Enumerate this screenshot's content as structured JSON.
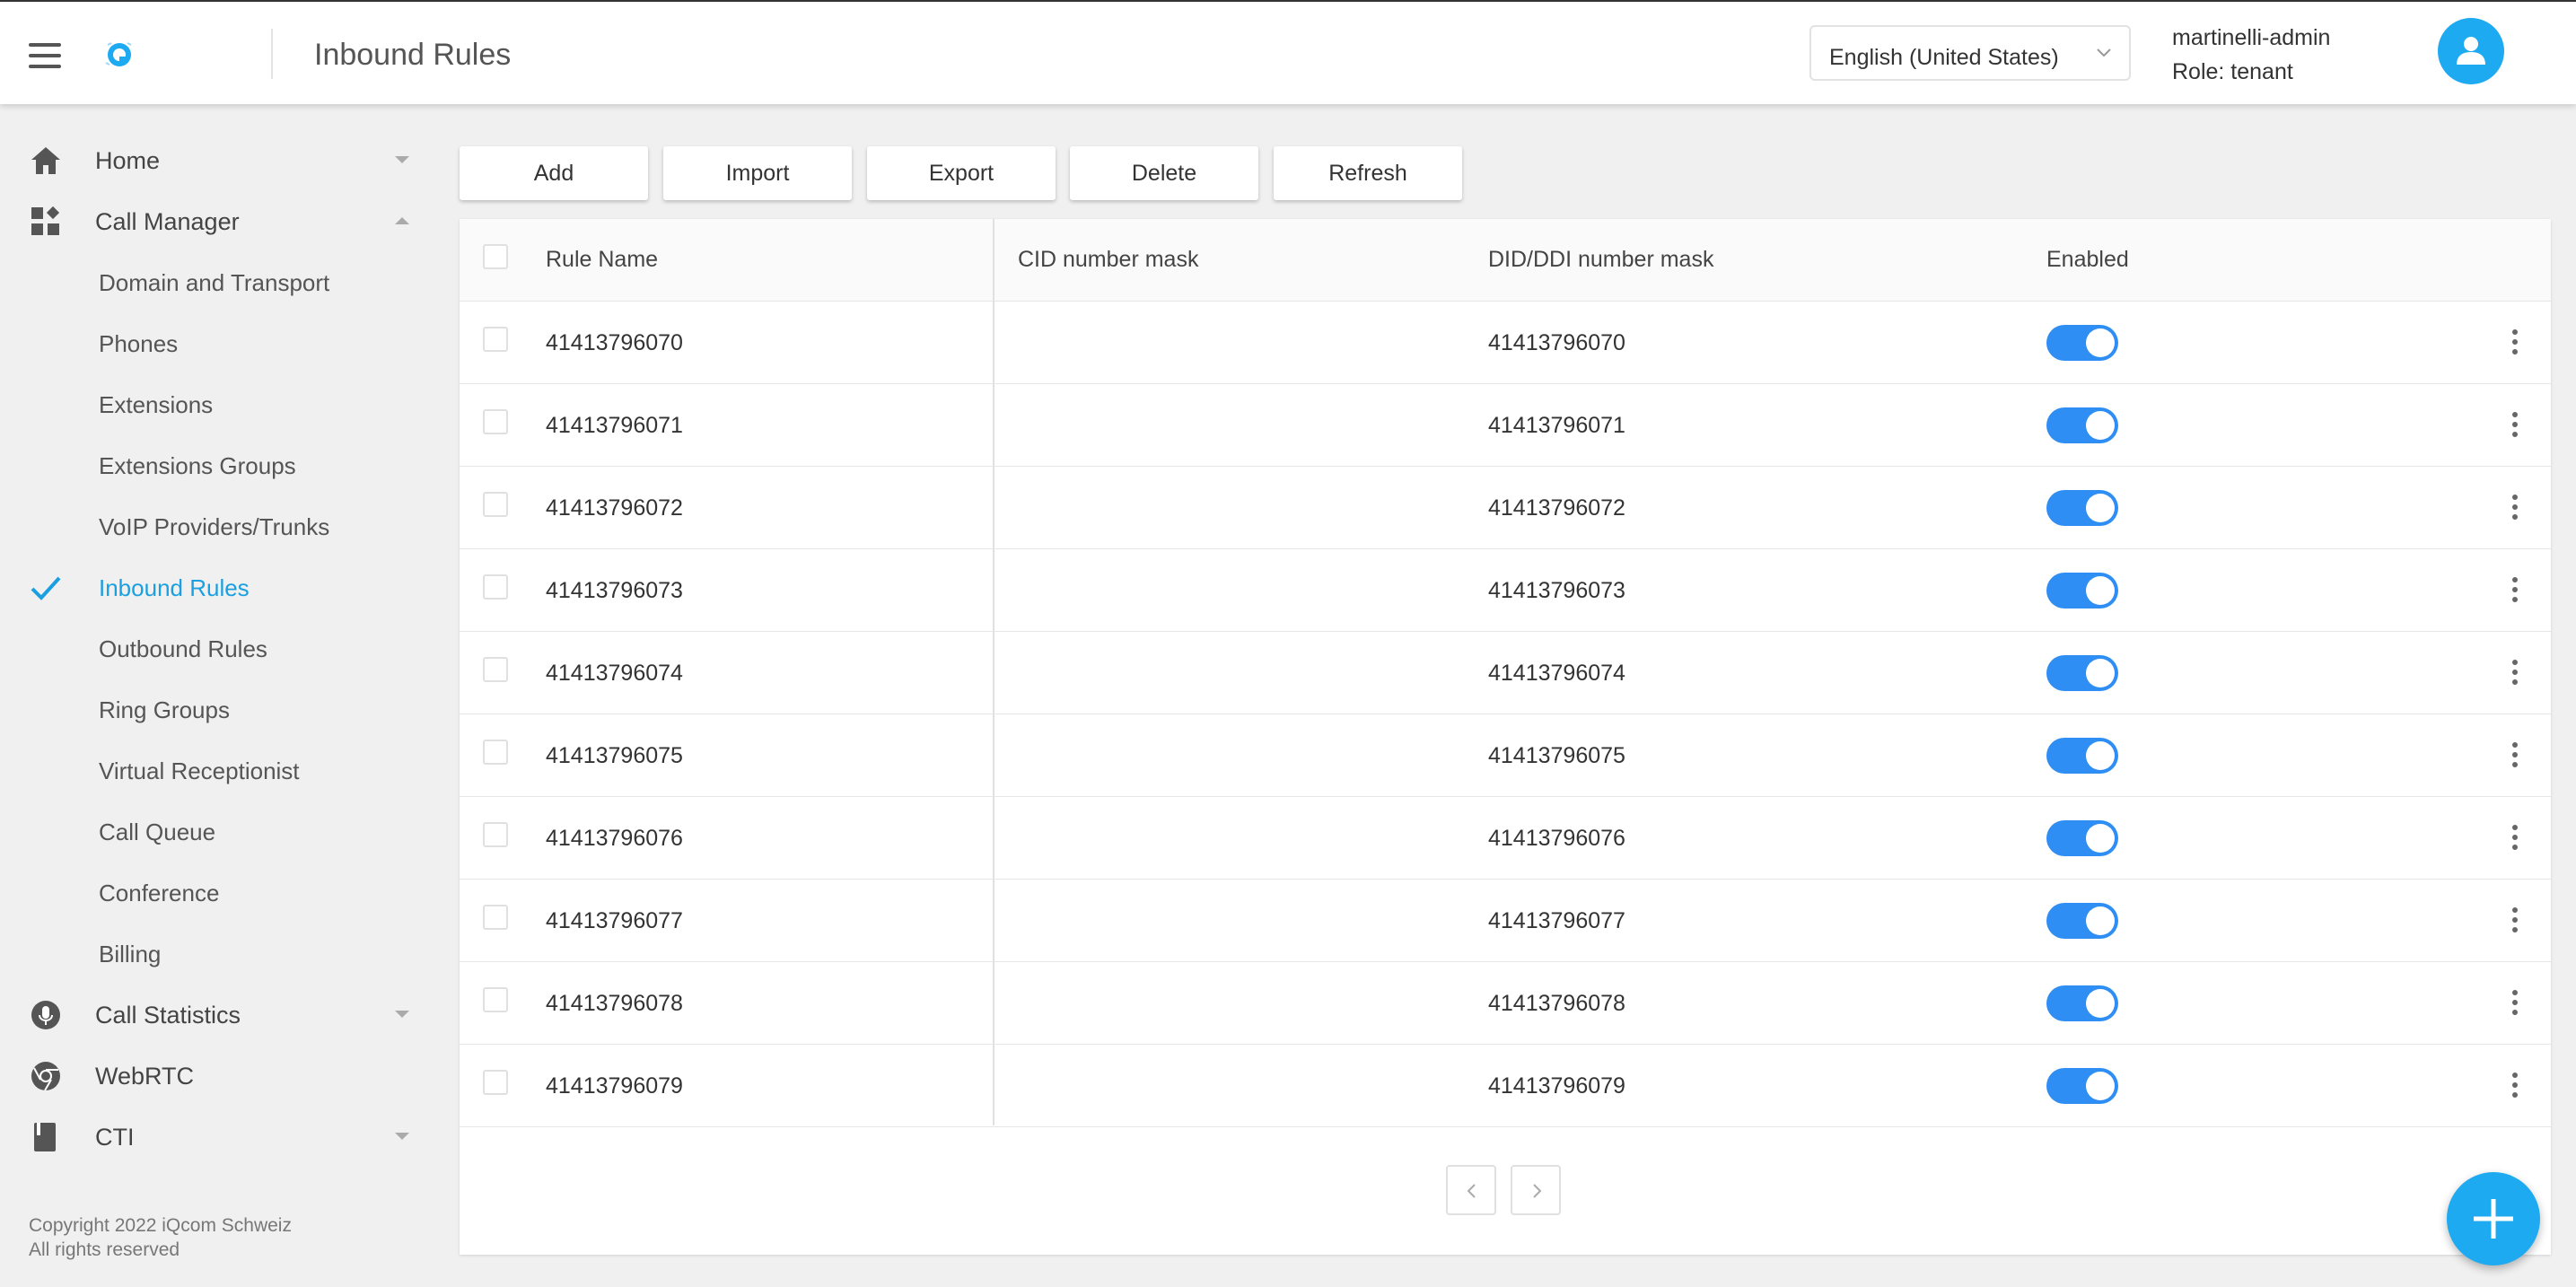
{
  "header": {
    "title": "Inbound Rules",
    "language": "English (United States)",
    "user_name": "martinelli-admin",
    "user_role": "Role: tenant",
    "accent_color": "#1eaaf1"
  },
  "sidebar": {
    "sections": [
      {
        "label": "Home",
        "icon": "home-icon",
        "expanded": false
      },
      {
        "label": "Call Manager",
        "icon": "dashboard-icon",
        "expanded": true
      },
      {
        "label": "Call Statistics",
        "icon": "microphone-icon",
        "expanded": false
      },
      {
        "label": "WebRTC",
        "icon": "chrome-icon",
        "expanded": null
      },
      {
        "label": "CTI",
        "icon": "book-icon",
        "expanded": false
      }
    ],
    "call_manager_items": [
      "Domain and Transport",
      "Phones",
      "Extensions",
      "Extensions Groups",
      "VoIP Providers/Trunks",
      "Inbound Rules",
      "Outbound Rules",
      "Ring Groups",
      "Virtual Receptionist",
      "Call Queue",
      "Conference",
      "Billing"
    ],
    "active_item": "Inbound Rules",
    "copyright_line1": "Copyright 2022 iQcom Schweiz",
    "copyright_line2": "All rights reserved"
  },
  "toolbar": {
    "add": "Add",
    "import": "Import",
    "export": "Export",
    "delete": "Delete",
    "refresh": "Refresh"
  },
  "table": {
    "columns": [
      "Rule Name",
      "CID number mask",
      "DID/DDI number mask",
      "Enabled"
    ],
    "rows": [
      {
        "rule_name": "41413796070",
        "cid": "",
        "did": "41413796070",
        "enabled": true
      },
      {
        "rule_name": "41413796071",
        "cid": "",
        "did": "41413796071",
        "enabled": true
      },
      {
        "rule_name": "41413796072",
        "cid": "",
        "did": "41413796072",
        "enabled": true
      },
      {
        "rule_name": "41413796073",
        "cid": "",
        "did": "41413796073",
        "enabled": true
      },
      {
        "rule_name": "41413796074",
        "cid": "",
        "did": "41413796074",
        "enabled": true
      },
      {
        "rule_name": "41413796075",
        "cid": "",
        "did": "41413796075",
        "enabled": true
      },
      {
        "rule_name": "41413796076",
        "cid": "",
        "did": "41413796076",
        "enabled": true
      },
      {
        "rule_name": "41413796077",
        "cid": "",
        "did": "41413796077",
        "enabled": true
      },
      {
        "rule_name": "41413796078",
        "cid": "",
        "did": "41413796078",
        "enabled": true
      },
      {
        "rule_name": "41413796079",
        "cid": "",
        "did": "41413796079",
        "enabled": true
      }
    ]
  },
  "pagination": {
    "prev_icon": "chevron-left-icon",
    "next_icon": "chevron-right-icon"
  },
  "fab": {
    "icon": "plus-icon"
  }
}
